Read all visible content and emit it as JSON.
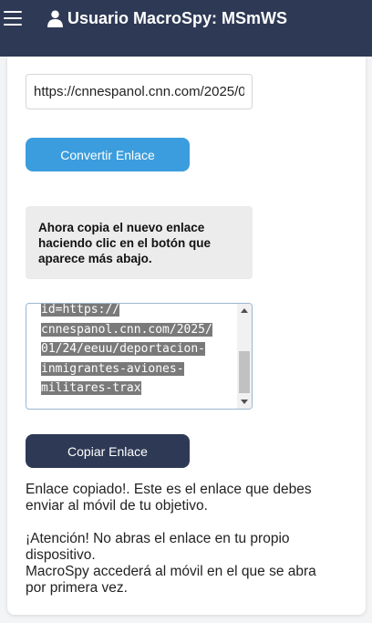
{
  "header": {
    "title": "Usuario MacroSpy: MSmWS",
    "menu_icon": "hamburger-menu-icon",
    "user_icon": "user-icon",
    "background": "#2e3a55"
  },
  "form": {
    "url_value": "https://cnnespanol.cnn.com/2025/01/24/eeuu/deportacion-inmigrantes-aviones-militares-trax",
    "convert_label": "Convertir Enlace",
    "convert_color": "#3b9ddd"
  },
  "instruction": {
    "text": "Ahora copia el nuevo enlace haciendo clic en el botón que aparece más abajo."
  },
  "result": {
    "lines": [
      "id=https://",
      "cnnespanol.cnn.com/2025/",
      "01/24/eeuu/deportacion-",
      "inmigrantes-aviones-",
      "militares-trax"
    ],
    "copy_label": "Copiar Enlace",
    "copy_color": "#2e3a55"
  },
  "messages": {
    "copied": "Enlace copiado!. Este es el enlace que debes enviar al móvil de tu objetivo.",
    "warning": "¡Atención! No abras el enlace en tu propio dispositivo.",
    "info": "MacroSpy accederá al móvil en el que se abra por primera vez."
  }
}
